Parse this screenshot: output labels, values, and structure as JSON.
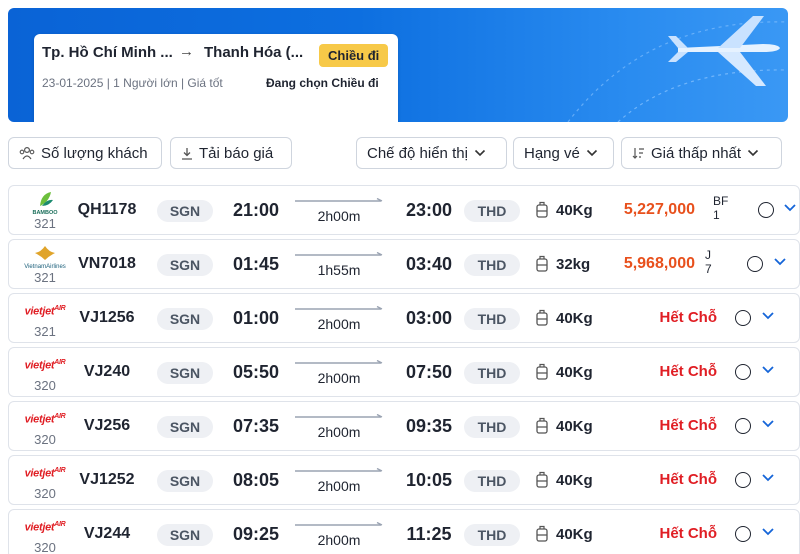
{
  "search": {
    "from": "Tp. Hồ Chí Minh ...",
    "arrow": "→",
    "to": "Thanh Hóa (...",
    "direction_badge": "Chiều đi",
    "meta": "23-01-2025 | 1 Người lớn | Giá tốt",
    "selecting": "Đang chọn Chiều đi"
  },
  "toolbar": {
    "passengers_label": "Số lượng khách",
    "quote_label": "Tải báo giá",
    "display_mode_label": "Chế độ hiển thị",
    "ticket_class_label": "Hạng vé",
    "sort_label": "Giá thấp nhất"
  },
  "colors": {
    "banner": "#0d6fe0",
    "badge": "#f7c948",
    "price": "#e8501c",
    "soldout": "#e01e24",
    "chevron": "#1565d8"
  },
  "icons": {
    "passengers": "group-icon",
    "quote": "download-icon",
    "sort": "sort-icon",
    "baggage": "luggage-icon",
    "expand": "chevron-down-icon"
  },
  "flights": [
    {
      "airline": "Bamboo",
      "logo_text": "BAMBOO",
      "aircraft": "321",
      "flight_no": "QH1178",
      "dep_airport": "SGN",
      "dep_time": "21:00",
      "duration": "2h00m",
      "arr_time": "23:00",
      "arr_airport": "THD",
      "baggage": "40Kg",
      "price": "5,227,000",
      "fare_class": "BF 1",
      "status": ""
    },
    {
      "airline": "Vietnam Airlines",
      "logo_text": "VietnamAirlines",
      "aircraft": "321",
      "flight_no": "VN7018",
      "dep_airport": "SGN",
      "dep_time": "01:45",
      "duration": "1h55m",
      "arr_time": "03:40",
      "arr_airport": "THD",
      "baggage": "32kg",
      "price": "5,968,000",
      "fare_class": "J 7",
      "status": ""
    },
    {
      "airline": "Vietjet",
      "logo_text": "VietJetAir",
      "aircraft": "321",
      "flight_no": "VJ1256",
      "dep_airport": "SGN",
      "dep_time": "01:00",
      "duration": "2h00m",
      "arr_time": "03:00",
      "arr_airport": "THD",
      "baggage": "40Kg",
      "price": "",
      "fare_class": "",
      "status": "Hết Chỗ"
    },
    {
      "airline": "Vietjet",
      "logo_text": "VietJetAir",
      "aircraft": "320",
      "flight_no": "VJ240",
      "dep_airport": "SGN",
      "dep_time": "05:50",
      "duration": "2h00m",
      "arr_time": "07:50",
      "arr_airport": "THD",
      "baggage": "40Kg",
      "price": "",
      "fare_class": "",
      "status": "Hết Chỗ"
    },
    {
      "airline": "Vietjet",
      "logo_text": "VietJetAir",
      "aircraft": "320",
      "flight_no": "VJ256",
      "dep_airport": "SGN",
      "dep_time": "07:35",
      "duration": "2h00m",
      "arr_time": "09:35",
      "arr_airport": "THD",
      "baggage": "40Kg",
      "price": "",
      "fare_class": "",
      "status": "Hết Chỗ"
    },
    {
      "airline": "Vietjet",
      "logo_text": "VietJetAir",
      "aircraft": "320",
      "flight_no": "VJ1252",
      "dep_airport": "SGN",
      "dep_time": "08:05",
      "duration": "2h00m",
      "arr_time": "10:05",
      "arr_airport": "THD",
      "baggage": "40Kg",
      "price": "",
      "fare_class": "",
      "status": "Hết Chỗ"
    },
    {
      "airline": "Vietjet",
      "logo_text": "VietJetAir",
      "aircraft": "320",
      "flight_no": "VJ244",
      "dep_airport": "SGN",
      "dep_time": "09:25",
      "duration": "2h00m",
      "arr_time": "11:25",
      "arr_airport": "THD",
      "baggage": "40Kg",
      "price": "",
      "fare_class": "",
      "status": "Hết Chỗ"
    }
  ]
}
